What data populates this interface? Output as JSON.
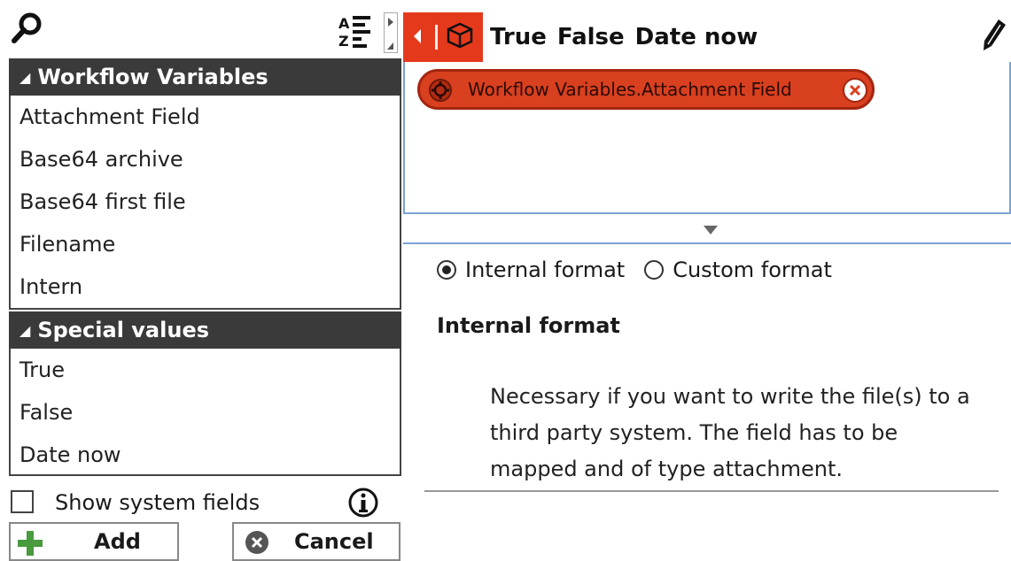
{
  "left": {
    "groups": [
      {
        "title": "Workflow Variables",
        "items": [
          "Attachment Field",
          "Base64 archive",
          "Base64 first file",
          "Filename",
          "Intern"
        ]
      },
      {
        "title": "Special values",
        "items": [
          "True",
          "False",
          "Date now"
        ]
      }
    ],
    "show_system_fields": {
      "label": "Show system fields",
      "checked": false
    },
    "buttons": {
      "add": "Add",
      "cancel": "Cancel"
    }
  },
  "right": {
    "tokens": [
      "True",
      "False",
      "Date now"
    ],
    "chip": {
      "label": "Workflow Variables.Attachment Field"
    },
    "format": {
      "options": [
        {
          "label": "Internal format",
          "selected": true
        },
        {
          "label": "Custom format",
          "selected": false
        }
      ],
      "title": "Internal format",
      "description": "Necessary if you want to write the file(s) to a third party system. The field has to be mapped and of type attachment."
    }
  },
  "colors": {
    "accent_red": "#e5391c",
    "header_dark": "#3a3a3a",
    "focus_blue": "#7aa3d4"
  },
  "icons": [
    "search-icon",
    "sort-az-icon",
    "box-icon",
    "pencil-icon",
    "gear-icon",
    "close-icon",
    "info-icon",
    "plus-icon",
    "cancel-icon",
    "chevron-down-icon"
  ]
}
